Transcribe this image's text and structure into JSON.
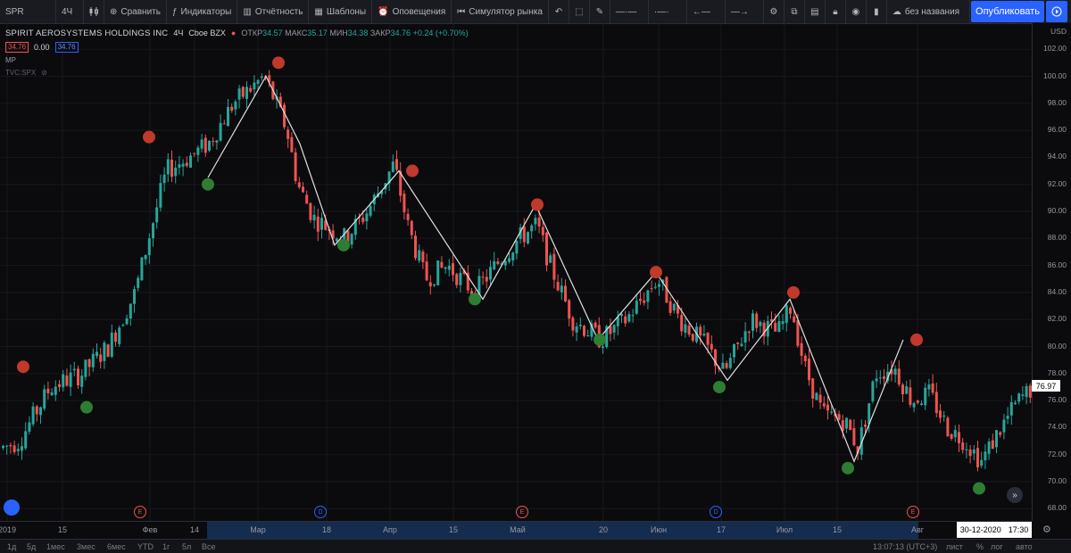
{
  "toolbar": {
    "symbol": "SPR",
    "interval": "4Ч",
    "compare": "Сравнить",
    "indicators": "Индикаторы",
    "financials": "Отчётность",
    "templates": "Шаблоны",
    "alerts": "Оповещения",
    "replay": "Симулятор рынка",
    "layout_name": "без названия",
    "publish": "Опубликовать"
  },
  "legend": {
    "title": "SPIRIT AEROSYSTEMS HOLDINGS INC",
    "interval": "4Ч",
    "exchange": "Cboe BZX",
    "open_label": "ОТКР",
    "open": "34.57",
    "high_label": "МАКС",
    "high": "35.17",
    "low_label": "МИН",
    "low": "34.38",
    "close_label": "ЗАКР",
    "close": "34.76",
    "change": "+0.24 (+0.70%)",
    "bid": "34.76",
    "spread": "0.00",
    "ask": "34.76",
    "indicator": "MP",
    "overlay": "TVC:SPX"
  },
  "price_axis": {
    "currency": "USD",
    "ticks": [
      "102.00",
      "100.00",
      "98.00",
      "96.00",
      "94.00",
      "92.00",
      "90.00",
      "88.00",
      "86.00",
      "84.00",
      "82.00",
      "80.00",
      "78.00",
      "76.00",
      "74.00",
      "72.00",
      "70.00",
      "68.00"
    ],
    "last_price": "76.97"
  },
  "time_axis": {
    "ticks": [
      "2019",
      "15",
      "Фев",
      "14",
      "Мар",
      "18",
      "Апр",
      "15",
      "Май",
      "20",
      "Июн",
      "17",
      "Июл",
      "15",
      "Авг"
    ],
    "cursor_date": "30-12-2020",
    "cursor_time": "17:30"
  },
  "events": [
    "E",
    "D",
    "E",
    "D",
    "E"
  ],
  "bottom": {
    "ranges": [
      "1д",
      "5д",
      "1мес",
      "3мес",
      "6мес",
      "YTD",
      "1г",
      "5л",
      "Все"
    ],
    "clock": "13:07:13 (UTC+3)",
    "right_items": [
      "лист",
      "%",
      "лог",
      "авто"
    ]
  },
  "colors": {
    "up": "#26a69a",
    "down": "#ef5350",
    "accent": "#2962ff",
    "zigzag": "#e0e0e0"
  },
  "chart_data": {
    "type": "candlestick",
    "ylim": [
      67,
      103
    ],
    "x_tick_labels": [
      "2019",
      "15",
      "Фев",
      "14",
      "Мар",
      "18",
      "Апр",
      "15",
      "Май",
      "20",
      "Июн",
      "17",
      "Июл",
      "15",
      "Авг"
    ],
    "trend_path_price_levels": [
      92.5,
      100.0,
      95.0,
      87.5,
      93.0,
      83.5,
      90.5,
      80.5,
      85.5,
      77.5,
      83.5,
      71.5,
      80.5
    ],
    "peaks": [
      78.5,
      95.5,
      101.0,
      93.0,
      90.5,
      85.5,
      84.0,
      80.5
    ],
    "troughs": [
      75.5,
      92.0,
      87.5,
      83.5,
      80.5,
      77.0,
      71.0,
      69.5
    ],
    "last": 76.97
  }
}
